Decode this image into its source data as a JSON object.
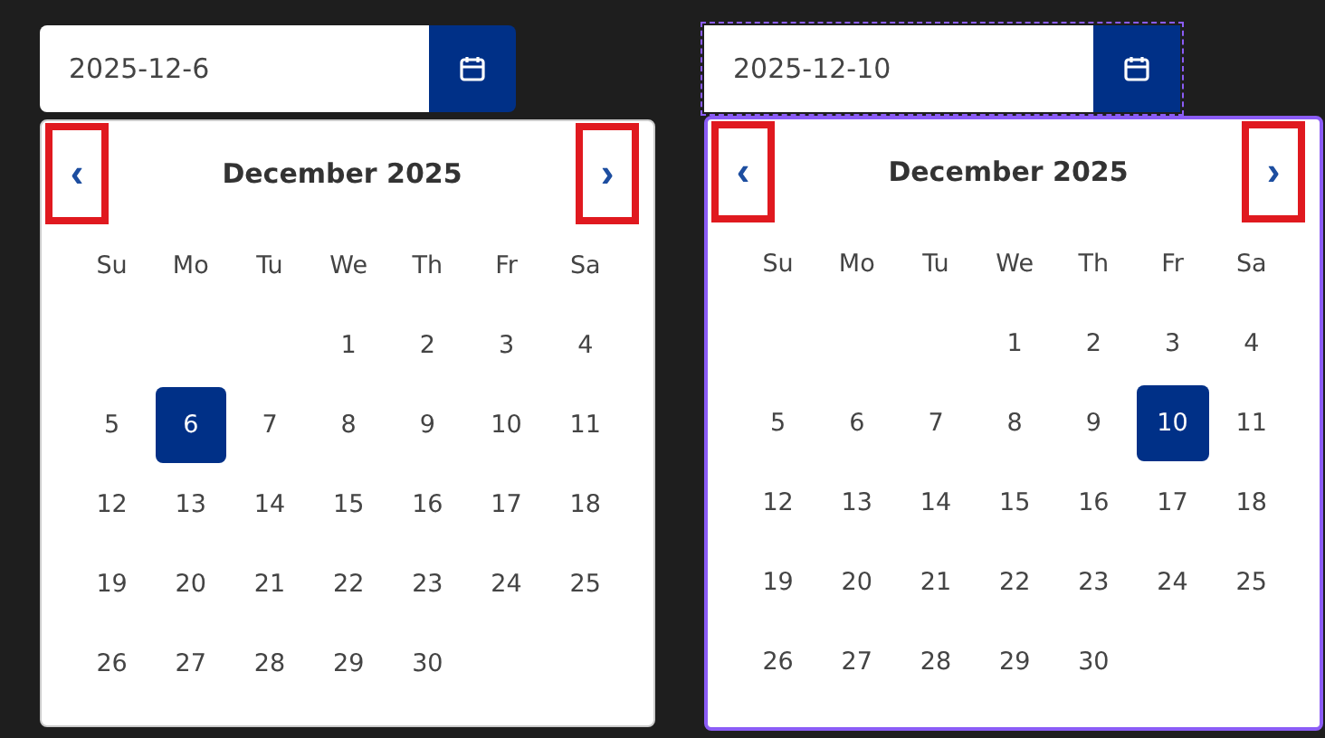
{
  "date_pickers": [
    {
      "value": "2025-12-6",
      "focused": false,
      "prev_label": "‹",
      "next_label": "›",
      "month_title": "December 2025",
      "weekdays": [
        "Su",
        "Mo",
        "Tu",
        "We",
        "Th",
        "Fr",
        "Sa"
      ],
      "weeks": [
        {
          "kind": "end_aligned",
          "days": [
            {
              "label": "1",
              "selected": false
            },
            {
              "label": "2",
              "selected": false
            },
            {
              "label": "3",
              "selected": false
            },
            {
              "label": "4",
              "selected": false
            }
          ]
        },
        {
          "kind": "full",
          "days": [
            {
              "label": "5",
              "selected": false
            },
            {
              "label": "6",
              "selected": true
            },
            {
              "label": "7",
              "selected": false
            },
            {
              "label": "8",
              "selected": false
            },
            {
              "label": "9",
              "selected": false
            },
            {
              "label": "10",
              "selected": false
            },
            {
              "label": "11",
              "selected": false
            }
          ]
        },
        {
          "kind": "full",
          "days": [
            {
              "label": "12",
              "selected": false
            },
            {
              "label": "13",
              "selected": false
            },
            {
              "label": "14",
              "selected": false
            },
            {
              "label": "15",
              "selected": false
            },
            {
              "label": "16",
              "selected": false
            },
            {
              "label": "17",
              "selected": false
            },
            {
              "label": "18",
              "selected": false
            }
          ]
        },
        {
          "kind": "full",
          "days": [
            {
              "label": "19",
              "selected": false
            },
            {
              "label": "20",
              "selected": false
            },
            {
              "label": "21",
              "selected": false
            },
            {
              "label": "22",
              "selected": false
            },
            {
              "label": "23",
              "selected": false
            },
            {
              "label": "24",
              "selected": false
            },
            {
              "label": "25",
              "selected": false
            }
          ]
        },
        {
          "kind": "start_aligned",
          "days": [
            {
              "label": "26",
              "selected": false
            },
            {
              "label": "27",
              "selected": false
            },
            {
              "label": "28",
              "selected": false
            },
            {
              "label": "29",
              "selected": false
            },
            {
              "label": "30",
              "selected": false
            }
          ]
        }
      ]
    },
    {
      "value": "2025-12-10",
      "focused": true,
      "prev_label": "‹",
      "next_label": "›",
      "month_title": "December 2025",
      "weekdays": [
        "Su",
        "Mo",
        "Tu",
        "We",
        "Th",
        "Fr",
        "Sa"
      ],
      "weeks": [
        {
          "kind": "end_aligned",
          "days": [
            {
              "label": "1",
              "selected": false
            },
            {
              "label": "2",
              "selected": false
            },
            {
              "label": "3",
              "selected": false
            },
            {
              "label": "4",
              "selected": false
            }
          ]
        },
        {
          "kind": "full",
          "days": [
            {
              "label": "5",
              "selected": false
            },
            {
              "label": "6",
              "selected": false
            },
            {
              "label": "7",
              "selected": false
            },
            {
              "label": "8",
              "selected": false
            },
            {
              "label": "9",
              "selected": false
            },
            {
              "label": "10",
              "selected": true
            },
            {
              "label": "11",
              "selected": false
            }
          ]
        },
        {
          "kind": "full",
          "days": [
            {
              "label": "12",
              "selected": false
            },
            {
              "label": "13",
              "selected": false
            },
            {
              "label": "14",
              "selected": false
            },
            {
              "label": "15",
              "selected": false
            },
            {
              "label": "16",
              "selected": false
            },
            {
              "label": "17",
              "selected": false
            },
            {
              "label": "18",
              "selected": false
            }
          ]
        },
        {
          "kind": "full",
          "days": [
            {
              "label": "19",
              "selected": false
            },
            {
              "label": "20",
              "selected": false
            },
            {
              "label": "21",
              "selected": false
            },
            {
              "label": "22",
              "selected": false
            },
            {
              "label": "23",
              "selected": false
            },
            {
              "label": "24",
              "selected": false
            },
            {
              "label": "25",
              "selected": false
            }
          ]
        },
        {
          "kind": "start_aligned",
          "days": [
            {
              "label": "26",
              "selected": false
            },
            {
              "label": "27",
              "selected": false
            },
            {
              "label": "28",
              "selected": false
            },
            {
              "label": "29",
              "selected": false
            },
            {
              "label": "30",
              "selected": false
            }
          ]
        }
      ]
    }
  ]
}
